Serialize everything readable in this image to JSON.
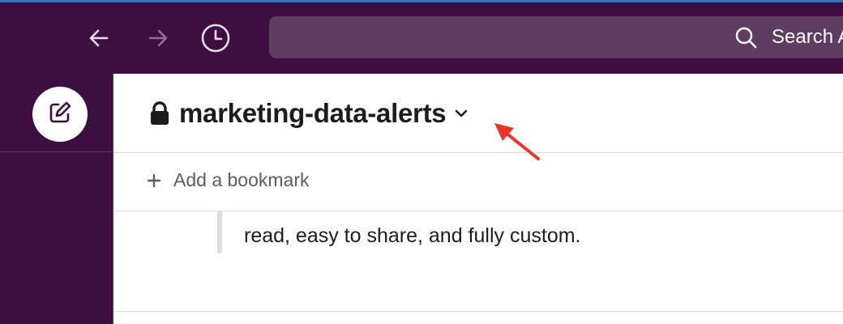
{
  "topbar": {
    "back_icon": "arrow-left-icon",
    "forward_icon": "arrow-right-icon",
    "history_icon": "clock-icon",
    "search": {
      "icon": "search-icon",
      "text": "Search A"
    }
  },
  "sidebar": {
    "compose_icon": "compose-icon"
  },
  "channel": {
    "lock_icon": "lock-icon",
    "name": "marketing-data-alerts",
    "chevron_icon": "chevron-down-icon"
  },
  "bookmarks": {
    "add_label": "Add a bookmark",
    "add_icon": "plus-icon"
  },
  "message": {
    "text": "read, easy to share, and fully custom."
  },
  "colors": {
    "aubergine": "#3f0e40",
    "search_bg": "#5f3c62",
    "annotation": "#e8352a"
  }
}
